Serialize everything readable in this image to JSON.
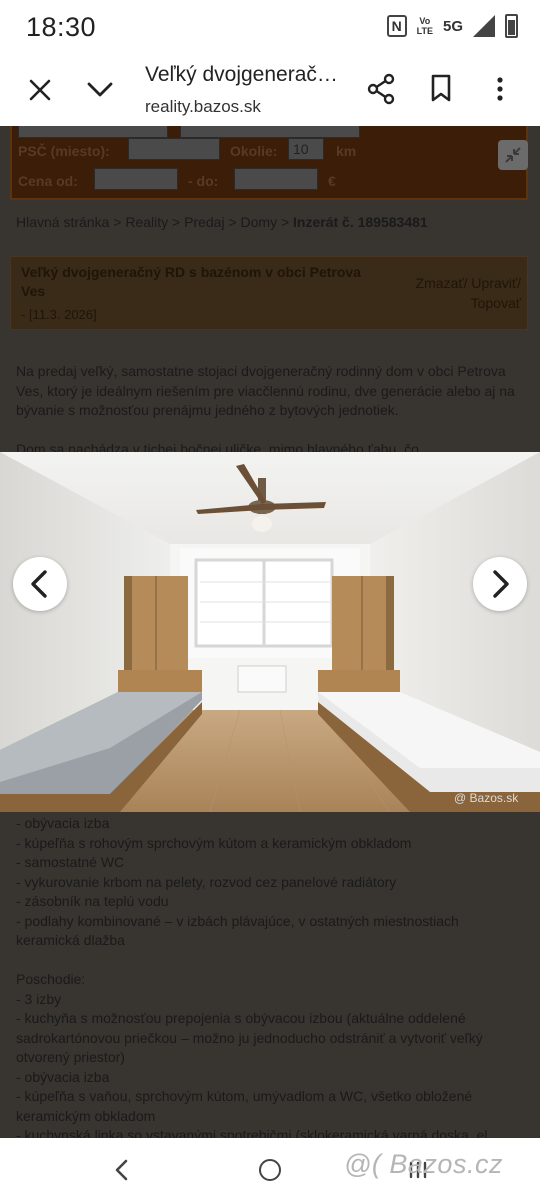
{
  "status_bar": {
    "time": "18:30",
    "volte_top": "Vo",
    "volte_bottom": "LTE",
    "network": "5G",
    "icons": [
      "nfc-icon",
      "volte-icon",
      "signal-icon",
      "battery-icon"
    ]
  },
  "toolbar": {
    "title": "Veľký dvojgenerační RD s bazénom v obci Petrova Ves",
    "url": "reality.bazos.sk",
    "icons": [
      "close-icon",
      "chevron-down-icon",
      "share-icon",
      "bookmark-icon",
      "more-vert-icon"
    ]
  },
  "search": {
    "psc_label": "PSČ (miesto):",
    "okolie_label": "Okolie:",
    "okolie_value": "10",
    "km_label": "km",
    "cena_label": "Cena od:",
    "do_label": "- do:",
    "currency": "€"
  },
  "breadcrumb": {
    "path": "Hlavná stránka > Reality > Predaj > Domy > ",
    "current": "Inzerát č. 189583481"
  },
  "listing": {
    "title": "Veľký dvojgeneračný RD s bazénom v obci Petrova Ves",
    "date": "- [11.3. 2026]",
    "actions": "Zmazať/ Upraviť/ Topovať"
  },
  "description": {
    "intro": "Na predaj veľký, samostatne stojaci dvojgeneračný rodinný dom v obci Petrova Ves, ktorý je ideálnym riešením pre viacčlennú rodinu, dve generácie alebo aj na bývanie s možnosťou prenájmu jedného z bytových jednotiek.",
    "partial": "Dom sa nachádza v tichej bočnej uličke, mimo hlavného ťahu, čo",
    "lines": [
      "- obývacia izba",
      "- kúpeľňa s rohovým sprchovým kútom a keramickým obkladom",
      "- samostatné WC",
      "- vykurovanie krbom na pelety, rozvod cez panelové radiátory",
      "- zásobník na teplú vodu",
      "- podlahy kombinované – v izbách plávajúce, v ostatných miestnostiach keramická dlažba",
      "",
      "Poschodie:",
      "- 3 izby",
      "- kuchyňa s možnosťou prepojenia s obývacou izbou (aktuálne oddelené sadrokartónovou priečkou – možno ju jednoducho odstrániť a vytvoriť veľký otvorený priestor)",
      "- obývacia izba",
      "- kúpeľňa s vaňou, sprchovým kútom, umývadlom a WC, všetko obložené keramickým obkladom",
      "- kuchynská linka so vstavanými spotrebičmi (sklokeramická varná doska, el."
    ]
  },
  "gallery": {
    "watermark": "@ Bazos.sk",
    "icons": [
      "chevron-left-icon",
      "chevron-right-icon"
    ]
  },
  "bottom_nav": {
    "brand_watermark": "@( Bazos.cz",
    "icons": [
      "back-icon",
      "home-icon",
      "recents-icon"
    ]
  },
  "colors": {
    "dim_overlay": "#383430",
    "search_bg": "#3b1d08"
  }
}
